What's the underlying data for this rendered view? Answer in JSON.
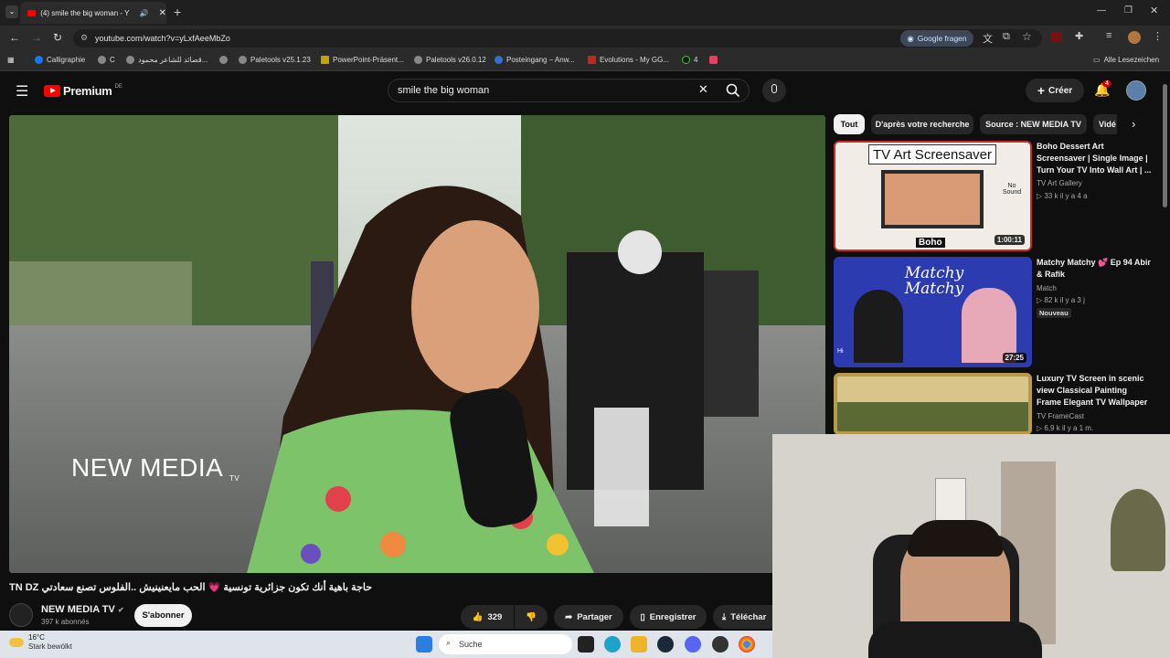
{
  "browser": {
    "tab_title": "(4) smile the big woman - Y",
    "url": "youtube.com/watch?v=yLxfAeeMbZo",
    "google_fragen": "Google fragen",
    "bookmarks": [
      "Calligraphie",
      "C",
      "قصائد للشاعر محمود...",
      "Paletools v25.1.23",
      "PowerPoint-Präsent...",
      "Paletools v26.0.12",
      "Posteingang – Anw...",
      "Evolutions - My GG...",
      "4",
      "Alle Lesezeichen"
    ]
  },
  "youtube": {
    "logo": "Premium",
    "logo_region": "DE",
    "search_query": "smile the big woman",
    "create_label": "Créer",
    "notif_count": "4",
    "video": {
      "overlay_logo": "NEW MEDIA",
      "overlay_logo_sub": "TV",
      "title": "TN DZ حاجة باهية أنك تكون جزائرية تونسية 💗 الحب مايعنينيش ..الفلوس تصنع سعادتي",
      "channel": "NEW MEDIA TV",
      "subscribers": "397 k abonnés",
      "subscribe_label": "S'abonner",
      "likes": "329",
      "share_label": "Partager",
      "save_label": "Enregistrer",
      "download_label": "Téléchar"
    },
    "chips": [
      "Tout",
      "D'après votre recherche",
      "Source : NEW MEDIA TV",
      "Vidé"
    ],
    "recommendations": [
      {
        "thumb_title": "TV Art Screensaver",
        "thumb_note": "Boho",
        "thumb_nosound": "No Sound",
        "duration": "1:00:11",
        "title": "Boho Dessert Art Screensaver | Single Image | Turn Your TV Into Wall Art | ...",
        "channel": "TV Art Gallery",
        "meta": "33 k  il y a 4 a",
        "badge": ""
      },
      {
        "thumb_title": "Matchy Matchy",
        "thumb_note": "Hi",
        "thumb_nosound": "",
        "duration": "27:25",
        "title": "Matchy Matchy 💕 Ep 94 Abir & Rafik",
        "channel": "Match",
        "meta": "82 k  il y a 3 j",
        "badge": "Nouveau"
      },
      {
        "thumb_title": "",
        "thumb_note": "",
        "thumb_nosound": "",
        "duration": "",
        "title": "Luxury TV Screen in scenic view Classical Painting Frame Elegant TV Wallpaper",
        "channel": "TV FrameCast",
        "meta": "6,9 k  il y a 1 m.",
        "badge": ""
      }
    ]
  },
  "taskbar": {
    "weather_temp": "16°C",
    "weather_desc": "Stark bewölkt",
    "search_placeholder": "Suche"
  }
}
